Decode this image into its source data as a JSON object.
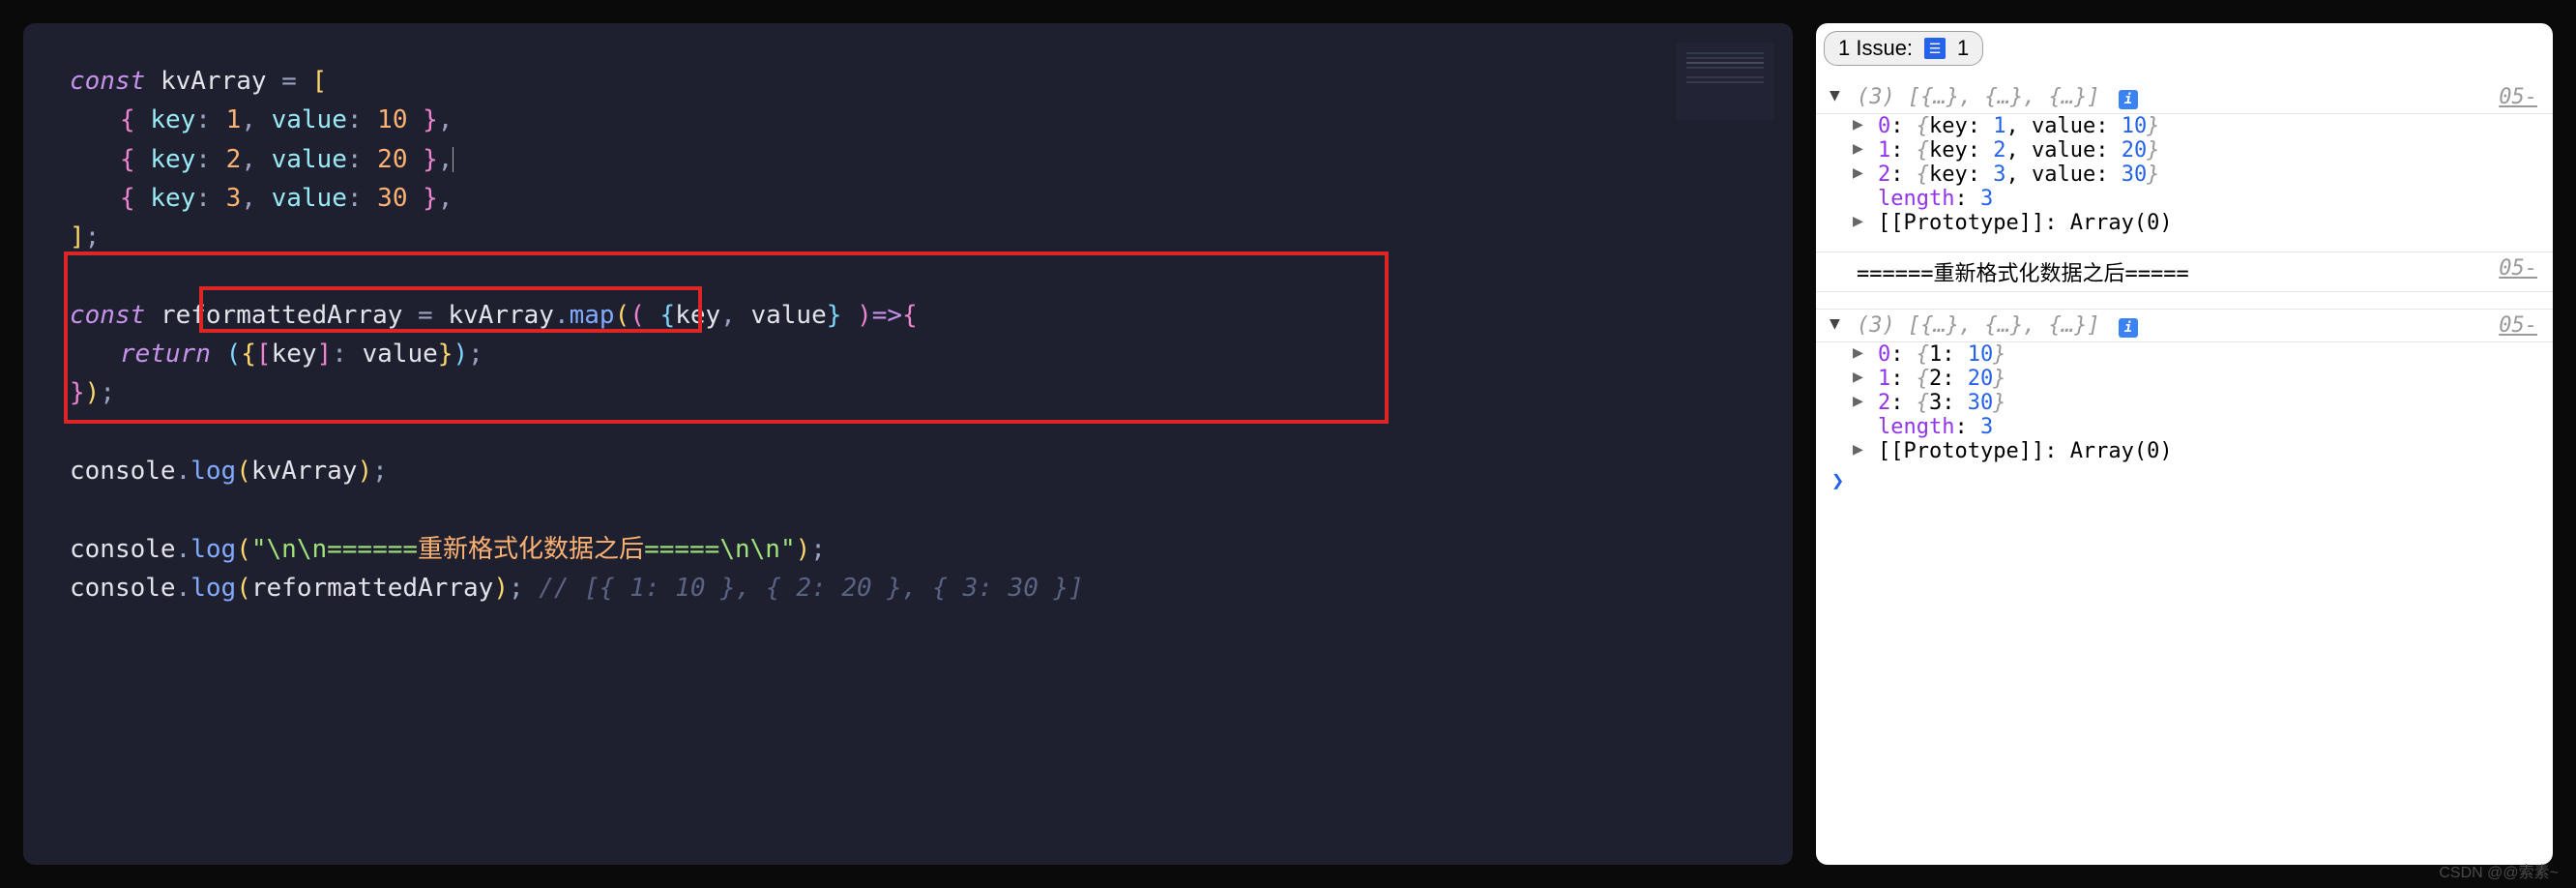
{
  "editor": {
    "lines": {
      "l1": "const",
      "var1": "kvArray",
      "eq": "=",
      "obj1_key": "key",
      "obj1_kval": "1",
      "obj1_v": "value",
      "obj1_vval": "10",
      "obj2_key": "key",
      "obj2_kval": "2",
      "obj2_v": "value",
      "obj2_vval": "20",
      "obj3_key": "key",
      "obj3_kval": "3",
      "obj3_v": "value",
      "obj3_vval": "30",
      "l7": "const",
      "var2": "reformattedArray",
      "mapfn": "map",
      "param_key": "key",
      "param_val": "value",
      "return": "return",
      "ret_key": "key",
      "ret_val": "value",
      "console": "console",
      "log": "log",
      "log1_arg": "kvArray",
      "log2_str_a": "\"\\n\\n======",
      "log2_str_b": "重新格式化数据之后",
      "log2_str_c": "=====\\n\\n\"",
      "log3_arg": "reformattedArray",
      "comment": "// [{ 1: 10 }, { 2: 20 }, { 3: 30 }]"
    }
  },
  "console": {
    "issues_label": "1 Issue:",
    "issues_count": "1",
    "arr1": {
      "summary": "(3) [{…}, {…}, {…}]",
      "items": [
        {
          "idx": "0",
          "key_label": "key",
          "key_val": "1",
          "val_label": "value",
          "val_val": "10"
        },
        {
          "idx": "1",
          "key_label": "key",
          "key_val": "2",
          "val_label": "value",
          "val_val": "20"
        },
        {
          "idx": "2",
          "key_label": "key",
          "key_val": "3",
          "val_label": "value",
          "val_val": "30"
        }
      ],
      "length_label": "length",
      "length_val": "3",
      "proto_label": "[[Prototype]]",
      "proto_val": "Array(0)"
    },
    "separator_text": "======重新格式化数据之后=====",
    "arr2": {
      "summary": "(3) [{…}, {…}, {…}]",
      "items": [
        {
          "idx": "0",
          "k": "1",
          "v": "10"
        },
        {
          "idx": "1",
          "k": "2",
          "v": "20"
        },
        {
          "idx": "2",
          "k": "3",
          "v": "30"
        }
      ],
      "length_label": "length",
      "length_val": "3",
      "proto_label": "[[Prototype]]",
      "proto_val": "Array(0)"
    },
    "float_label": "05-",
    "prompt": "❯"
  },
  "watermark": "CSDN @@索素~",
  "chart_data": null
}
